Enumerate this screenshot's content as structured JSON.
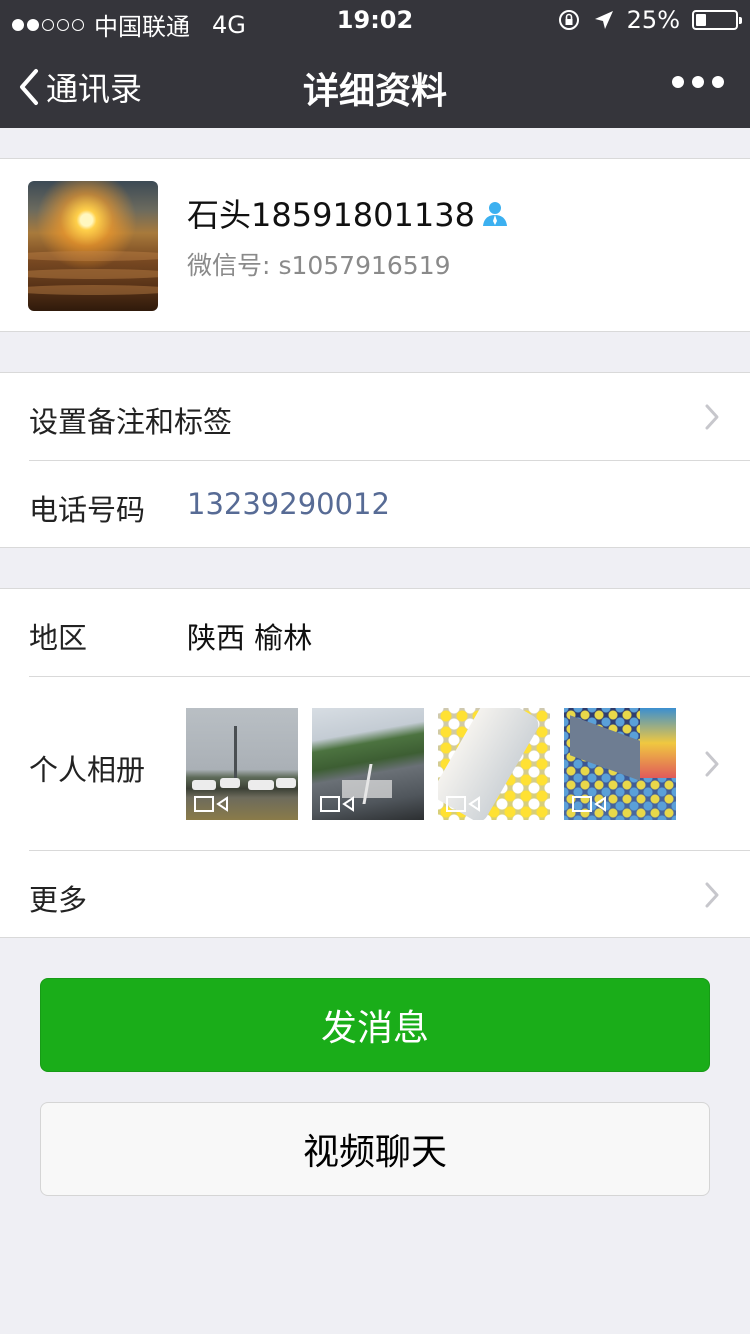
{
  "status_bar": {
    "carrier": "中国联通",
    "network": "4G",
    "time": "19:02",
    "battery_percent": "25%",
    "battery_level": 0.25,
    "signal_bars": 2,
    "icons": [
      "orientation-lock-icon",
      "location-arrow-icon",
      "battery-icon"
    ]
  },
  "nav": {
    "back_label": "通讯录",
    "title": "详细资料",
    "more_icon": "more-dots-icon"
  },
  "profile": {
    "name": "石头18591801138",
    "badge_icon": "person-icon",
    "wechat_id_label": "微信号:",
    "wechat_id": "s1057916519"
  },
  "rows": {
    "remark": {
      "label": "设置备注和标签"
    },
    "phone": {
      "label": "电话号码",
      "value": "13239290012"
    },
    "region": {
      "label": "地区",
      "value": "陕西 榆林"
    },
    "album": {
      "label": "个人相册",
      "thumbnails": [
        "video-thumbnail",
        "video-thumbnail",
        "video-thumbnail",
        "video-thumbnail"
      ]
    },
    "more": {
      "label": "更多"
    }
  },
  "buttons": {
    "send_message": "发消息",
    "video_chat": "视频聊天"
  },
  "colors": {
    "nav_bg": "#35353b",
    "primary_green": "#1aad19",
    "link_blue": "#576b95",
    "page_bg": "#efeff4"
  }
}
